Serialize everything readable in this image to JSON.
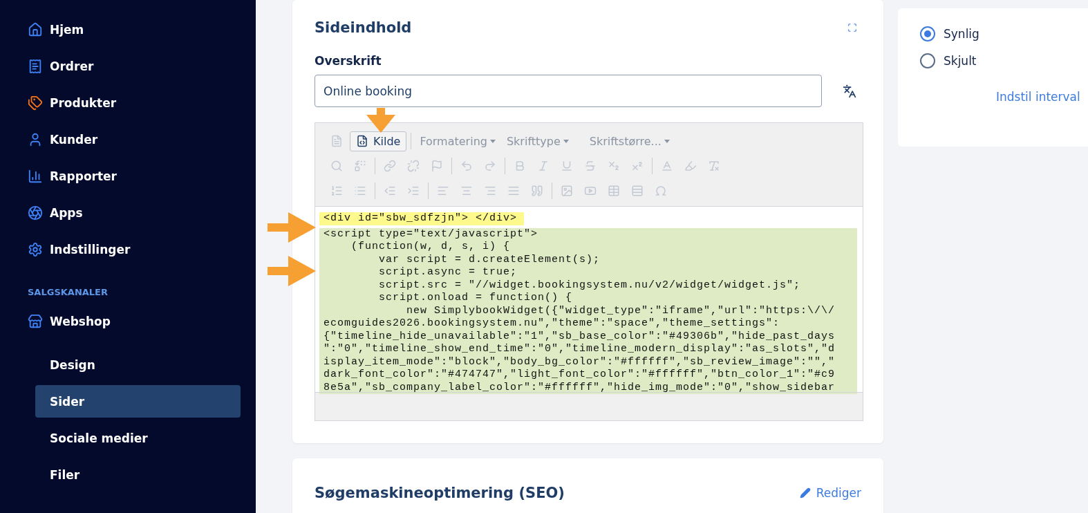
{
  "sidebar": {
    "items": [
      {
        "label": "Hjem",
        "selected": false
      },
      {
        "label": "Ordrer",
        "selected": false
      },
      {
        "label": "Produkter",
        "selected": false
      },
      {
        "label": "Kunder",
        "selected": false
      },
      {
        "label": "Rapporter",
        "selected": false
      },
      {
        "label": "Apps",
        "selected": false
      },
      {
        "label": "Indstillinger",
        "selected": false
      }
    ],
    "section_title": "SALGSKANALER",
    "channel": {
      "label": "Webshop"
    },
    "subitems": [
      {
        "label": "Design",
        "selected": false
      },
      {
        "label": "Sider",
        "selected": true
      },
      {
        "label": "Sociale medier",
        "selected": false
      },
      {
        "label": "Filer",
        "selected": false
      }
    ]
  },
  "content_card": {
    "title": "Sideindhold",
    "field_label": "Overskrift",
    "field_value": "Online booking",
    "editor": {
      "source_button": "Kilde",
      "dropdowns": [
        {
          "label": "Formatering",
          "disabled": true
        },
        {
          "label": "Skrifttype",
          "disabled": true
        },
        {
          "label": "Skriftstørre...",
          "disabled": true
        }
      ],
      "code_blocks": [
        {
          "color": "#fdf98c",
          "full_width": false,
          "lines": [
            "<div id=\"sbw_sdfzjn\"> </div>"
          ]
        },
        {
          "color": "#dfebc4",
          "full_width": true,
          "lines": [
            "<script type=\"text/javascript\">",
            "    (function(w, d, s, i) {",
            "        var script = d.createElement(s);",
            "        script.async = true;",
            "        script.src = \"//widget.bookingsystem.nu/v2/widget/widget.js\";",
            "        script.onload = function() {",
            "            new SimplybookWidget({\"widget_type\":\"iframe\",\"url\":\"https:\\/\\/",
            "ecomguides2026.bookingsystem.nu\",\"theme\":\"space\",\"theme_settings\":",
            "{\"timeline_hide_unavailable\":\"1\",\"sb_base_color\":\"#49306b\",\"hide_past_days",
            "\":\"0\",\"timeline_show_end_time\":\"0\",\"timeline_modern_display\":\"as_slots\",\"d",
            "isplay_item_mode\":\"block\",\"body_bg_color\":\"#ffffff\",\"sb_review_image\":\"\",\"",
            "dark_font_color\":\"#474747\",\"light_font_color\":\"#ffffff\",\"btn_color_1\":\"#c9",
            "8e5a\",\"sb_company_label_color\":\"#ffffff\",\"hide_img_mode\":\"0\",\"show_sidebar"
          ]
        }
      ]
    }
  },
  "visibility_card": {
    "options": [
      {
        "label": "Synlig",
        "selected": true
      },
      {
        "label": "Skjult",
        "selected": false
      }
    ],
    "link": "Indstil interval"
  },
  "seo_card": {
    "title": "Søgemaskineoptimering (SEO)",
    "edit_link": "Rediger"
  }
}
